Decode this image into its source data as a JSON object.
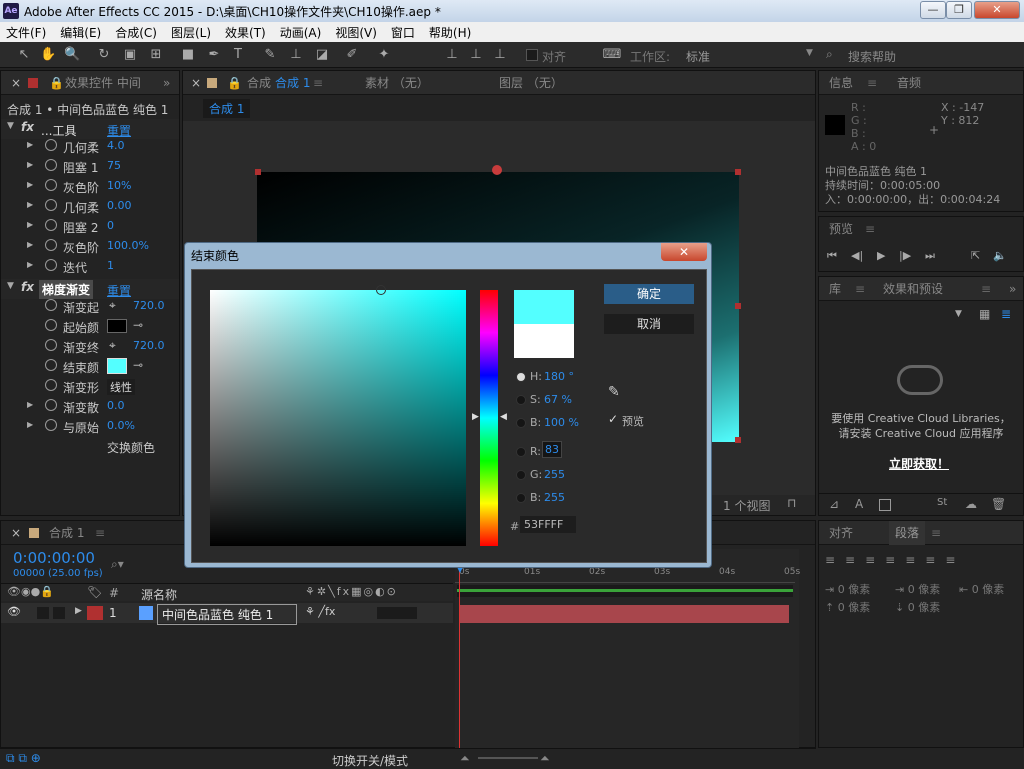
{
  "app": {
    "icon": "Ae",
    "title": "Adobe After Effects CC 2015 - D:\\桌面\\CH10操作文件夹\\CH10操作.aep *"
  },
  "window_buttons": {
    "minimize": "—",
    "maximize": "❐",
    "close": "✕"
  },
  "menu": [
    "文件(F)",
    "编辑(E)",
    "合成(C)",
    "图层(L)",
    "效果(T)",
    "动画(A)",
    "视图(V)",
    "窗口",
    "帮助(H)"
  ],
  "toolbar": {
    "snap_label": "对齐",
    "workspace_label": "工作区:",
    "workspace_value": "标准",
    "search_placeholder": "搜索帮助"
  },
  "effect_panel": {
    "tab": "效果控件 中间",
    "header": "合成 1 • 中间色品蓝色 纯色 1",
    "fx1_name": "...工具",
    "reset": "重置",
    "props1": [
      {
        "name": "几何柔",
        "value": "4.0"
      },
      {
        "name": "阻塞 1",
        "value": "75"
      },
      {
        "name": "灰色阶",
        "value": "10%"
      },
      {
        "name": "几何柔",
        "value": "0.00"
      },
      {
        "name": "阻塞 2",
        "value": "0"
      },
      {
        "name": "灰色阶",
        "value": "100.0%"
      },
      {
        "name": "迭代",
        "value": "1"
      }
    ],
    "fx2_name": "梯度渐变",
    "props2": [
      {
        "name": "渐变起",
        "value": "720.0"
      },
      {
        "name": "起始颜",
        "value": ""
      },
      {
        "name": "渐变终",
        "value": "720.0"
      },
      {
        "name": "结束颜",
        "value": ""
      },
      {
        "name": "渐变形",
        "value": "线性"
      },
      {
        "name": "渐变散",
        "value": "0.0"
      },
      {
        "name": "与原始",
        "value": "0.0%"
      }
    ],
    "swap_label": "交换颜色"
  },
  "comp_panel": {
    "tab": "合成",
    "tab_name": "合成 1",
    "tab_footage": "素材 （无）",
    "tab_layer": "图层 （无）",
    "breadcrumb": "合成 1",
    "views_label": "1 个视图"
  },
  "info_panel": {
    "tab_info": "信息",
    "tab_audio": "音频",
    "r": "R :",
    "g": "G :",
    "b": "B :",
    "a": "A : 0",
    "x": "X : -147",
    "y": "Y : 812",
    "layer_name": "中间色品蓝色 纯色 1",
    "duration": "持续时间：0:00:05:00",
    "inout": "入：0:00:00:00，出：0:00:04:24"
  },
  "preview_panel": {
    "tab": "预览"
  },
  "library_panel": {
    "tab_lib": "库",
    "tab_fx": "效果和预设",
    "msg1": "要使用 Creative Cloud Libraries，",
    "msg2": "请安装 Creative Cloud 应用程序",
    "link": "立即获取！"
  },
  "paragraph_panel": {
    "tab_align": "对齐",
    "tab_para": "段落",
    "indent1": "0 像素",
    "indent2": "0 像素",
    "indent3": "0 像素",
    "space1": "0 像素",
    "space2": "0 像素"
  },
  "timeline": {
    "tab": "合成 1",
    "timecode": "0:00:00:00",
    "fps": "00000 (25.00 fps)",
    "col_hash": "#",
    "col_source": "源名称",
    "layer_num": "1",
    "layer_name": "中间色品蓝色 纯色 1",
    "ruler": [
      "0s",
      "01s",
      "02s",
      "03s",
      "04s",
      "05s"
    ],
    "footer": "切换开关/模式"
  },
  "color_dialog": {
    "title": "结束颜色",
    "ok": "确定",
    "cancel": "取消",
    "preview_label": "预览",
    "h_label": "H:",
    "h_value": "180 °",
    "s_label": "S:",
    "s_value": "67 %",
    "b_label": "B:",
    "b_value": "100 %",
    "r_label": "R:",
    "r_value": "83",
    "g_label": "G:",
    "g_value": "255",
    "bb_label": "B:",
    "bb_value": "255",
    "hex_label": "#",
    "hex_value": "53FFFF",
    "new_color": "#53ffff",
    "old_color": "#ffffff"
  },
  "colors": {
    "accent": "#2d8ceb",
    "layer_bar": "#a8464c",
    "layer_label": "#b03030",
    "cyan": "#53ffff"
  }
}
